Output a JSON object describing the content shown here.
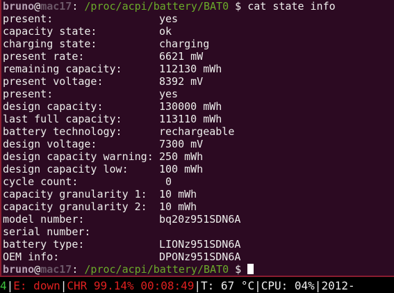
{
  "prompt": {
    "user": "bruno",
    "at": "@",
    "host": "mac17",
    "sep": ": ",
    "path": "/proc/acpi/battery/BAT0",
    "symbol": " $ ",
    "command": "cat state info"
  },
  "output": [
    {
      "key": "present:",
      "value": "yes"
    },
    {
      "key": "capacity state:",
      "value": "ok"
    },
    {
      "key": "charging state:",
      "value": "charging"
    },
    {
      "key": "present rate:",
      "value": "6621 mW"
    },
    {
      "key": "remaining capacity:",
      "value": "112130 mWh"
    },
    {
      "key": "present voltage:",
      "value": "8392 mV"
    },
    {
      "key": "present:",
      "value": "yes"
    },
    {
      "key": "design capacity:",
      "value": "130000 mWh"
    },
    {
      "key": "last full capacity:",
      "value": "113110 mWh"
    },
    {
      "key": "battery technology:",
      "value": "rechargeable"
    },
    {
      "key": "design voltage:",
      "value": "7300 mV"
    },
    {
      "key": "design capacity warning:",
      "value": "250 mWh"
    },
    {
      "key": "design capacity low:",
      "value": "100 mWh"
    },
    {
      "key": "cycle count:",
      "value": " 0"
    },
    {
      "key": "capacity granularity 1:",
      "value": "10 mWh"
    },
    {
      "key": "capacity granularity 2:",
      "value": "10 mWh"
    },
    {
      "key": "model number:",
      "value": "bq20z951SDN6A"
    },
    {
      "key": "serial number:",
      "value": ""
    },
    {
      "key": "battery type:",
      "value": "LIONz951SDN6A"
    },
    {
      "key": "OEM info:",
      "value": "DPONz951SDN6A"
    }
  ],
  "statusbar": {
    "desktop": "4",
    "sep": "|",
    "eth": "E: down",
    "battery": "CHR 99.14% 00:08:49",
    "temp": "T: 67 °C",
    "cpu": "CPU: 04%",
    "date": "2012-"
  }
}
